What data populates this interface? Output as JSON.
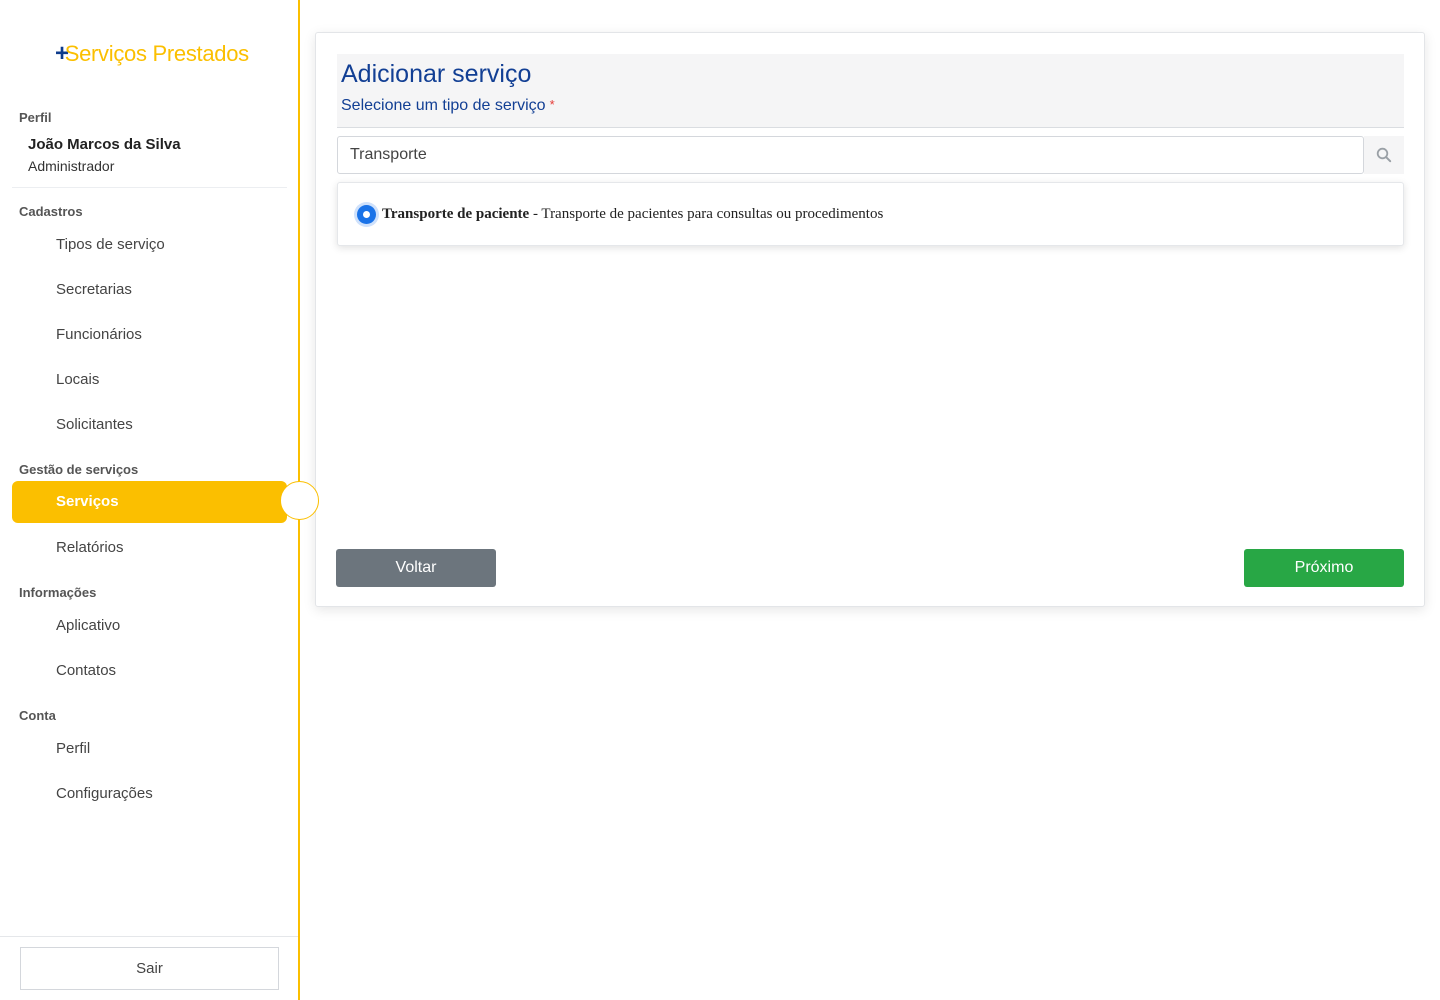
{
  "app": {
    "logo_plus": "+",
    "logo_text": "Serviços Prestados",
    "brand_color": "#fbbf00",
    "accent_color": "#123f94"
  },
  "sidebar": {
    "profile_section": "Perfil",
    "user_name": "João Marcos da Silva",
    "user_role": "Administrador",
    "sections": [
      {
        "label": "Cadastros",
        "items": [
          "Tipos de serviço",
          "Secretarias",
          "Funcionários",
          "Locais",
          "Solicitantes"
        ]
      },
      {
        "label": "Gestão de serviços",
        "items": [
          "Serviços",
          "Relatórios"
        ]
      },
      {
        "label": "Informações",
        "items": [
          "Aplicativo",
          "Contatos"
        ]
      },
      {
        "label": "Conta",
        "items": [
          "Perfil",
          "Configurações"
        ]
      }
    ],
    "active_item": "Serviços",
    "logout_label": "Sair"
  },
  "main": {
    "title": "Adicionar serviço",
    "subtitle": "Selecione um tipo de serviço",
    "required_mark": "*",
    "search": {
      "value": "Transporte",
      "icon": "search-icon"
    },
    "options": [
      {
        "name": "Transporte de paciente",
        "description": "- Transporte de pacientes para consultas ou procedimentos",
        "selected": true
      }
    ],
    "back_label": "Voltar",
    "next_label": "Próximo"
  }
}
